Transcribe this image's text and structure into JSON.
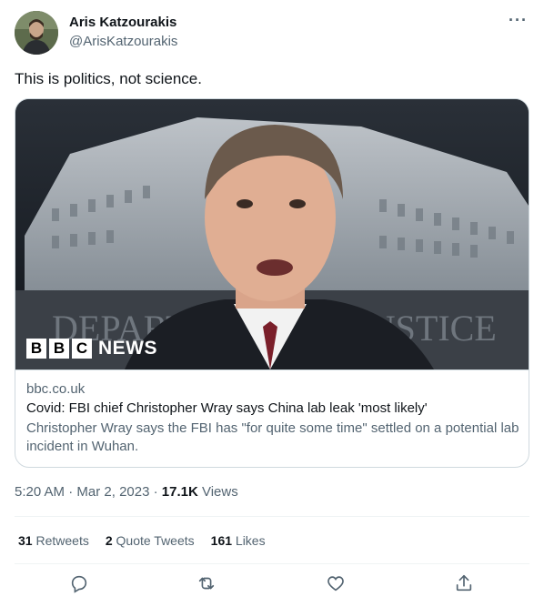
{
  "author": {
    "name": "Aris Katzourakis",
    "handle": "@ArisKatzourakis"
  },
  "tweet": {
    "text": "This is politics, not science."
  },
  "card": {
    "domain": "bbc.co.uk",
    "title": "Covid: FBI chief Christopher Wray says China lab leak 'most likely'",
    "description": "Christopher Wray says the FBI has \"for quite some time\" settled on a potential lab incident in Wuhan.",
    "image_logo": {
      "letters": [
        "B",
        "B",
        "C"
      ],
      "word": "NEWS"
    },
    "image_building_text": "DEPARTMENT OF JUSTICE"
  },
  "meta": {
    "time": "5:20 AM",
    "date": "Mar 2, 2023",
    "views_count": "17.1K",
    "views_label": "Views"
  },
  "stats": {
    "retweets_count": "31",
    "retweets_label": "Retweets",
    "quotes_count": "2",
    "quotes_label": "Quote Tweets",
    "likes_count": "161",
    "likes_label": "Likes"
  },
  "icons": {
    "more": "more-horizontal-icon",
    "reply": "reply-icon",
    "retweet": "retweet-icon",
    "like": "heart-icon",
    "share": "share-icon"
  },
  "colors": {
    "text_primary": "#0f1419",
    "text_secondary": "#536471",
    "border": "#cfd9de"
  }
}
